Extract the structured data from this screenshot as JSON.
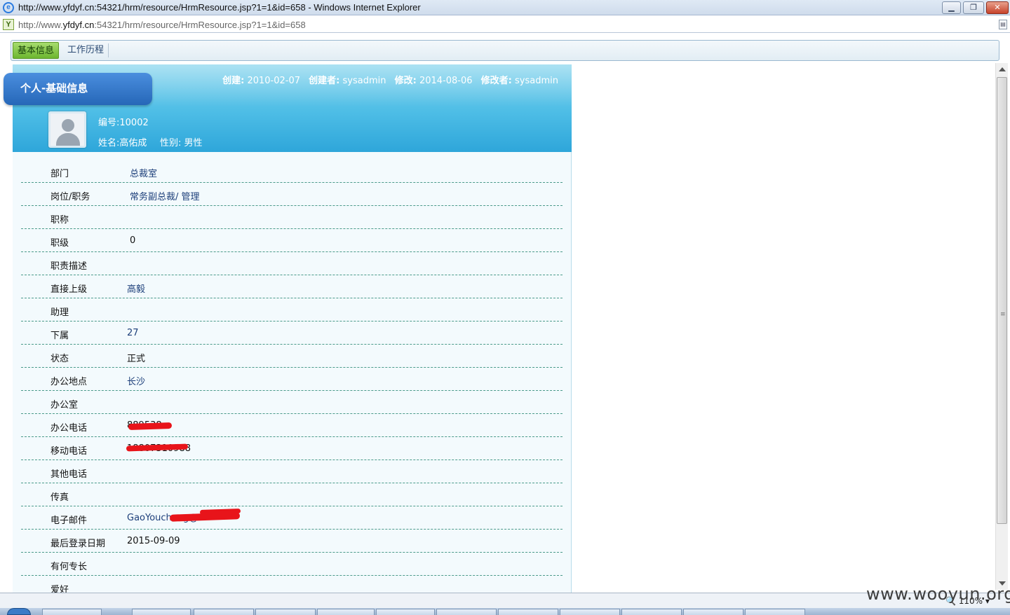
{
  "window": {
    "title": "http://www.yfdyf.cn:54321/hrm/resource/HrmResource.jsp?1=1&id=658 - Windows Internet Explorer",
    "minimize_glyph": "▁",
    "maximize_glyph": "❐",
    "close_glyph": "✕"
  },
  "address": {
    "prefix": "http://www.",
    "host": "yfdyf.cn",
    "rest": ":54321/hrm/resource/HrmResource.jsp?1=1&id=658"
  },
  "tabs": [
    {
      "label": "基本信息",
      "active": true
    },
    {
      "label": "工作历程",
      "active": false
    }
  ],
  "header": {
    "section_title": "个人-基础信息",
    "created_label": "创建:",
    "created_value": "2010-02-07",
    "creator_label": "创建者:",
    "creator_value": "sysadmin",
    "modified_label": "修改:",
    "modified_value": "2014-08-06",
    "modifier_label": "修改者:",
    "modifier_value": "sysadmin",
    "employee_no": "编号:10002",
    "name": "姓名:高佑成",
    "gender": "性别: 男性"
  },
  "fields": [
    {
      "label": "部门",
      "value": "总裁室"
    },
    {
      "label": "岗位/职务",
      "value": "常务副总裁/ 管理"
    },
    {
      "label": "职称",
      "value": ""
    },
    {
      "label": "职级",
      "value": "0"
    },
    {
      "label": "职责描述",
      "value": ""
    },
    {
      "label": "直接上级",
      "value": "高毅"
    },
    {
      "label": "助理",
      "value": ""
    },
    {
      "label": "下属",
      "value": "27"
    },
    {
      "label": "状态",
      "value": "正式"
    },
    {
      "label": "办公地点",
      "value": "长沙"
    },
    {
      "label": "办公室",
      "value": ""
    },
    {
      "label": "办公电话",
      "value": "889538"
    },
    {
      "label": "移动电话",
      "value": "18807310988"
    },
    {
      "label": "其他电话",
      "value": ""
    },
    {
      "label": "传真",
      "value": ""
    },
    {
      "label": "电子邮件",
      "value": "GaoYoucheng@"
    },
    {
      "label": "最后登录日期",
      "value": "2015-09-09"
    },
    {
      "label": "有何专长",
      "value": ""
    },
    {
      "label": "爱好",
      "value": ""
    }
  ],
  "status": {
    "zoom": "110%",
    "watermark": "www.wooyun.org"
  },
  "colors": {
    "banner": "#4dbde6",
    "section_tab": "#2667b8",
    "active_tab": "#6cb62f",
    "link": "#1d3f7a",
    "redaction": "#e8141a"
  }
}
